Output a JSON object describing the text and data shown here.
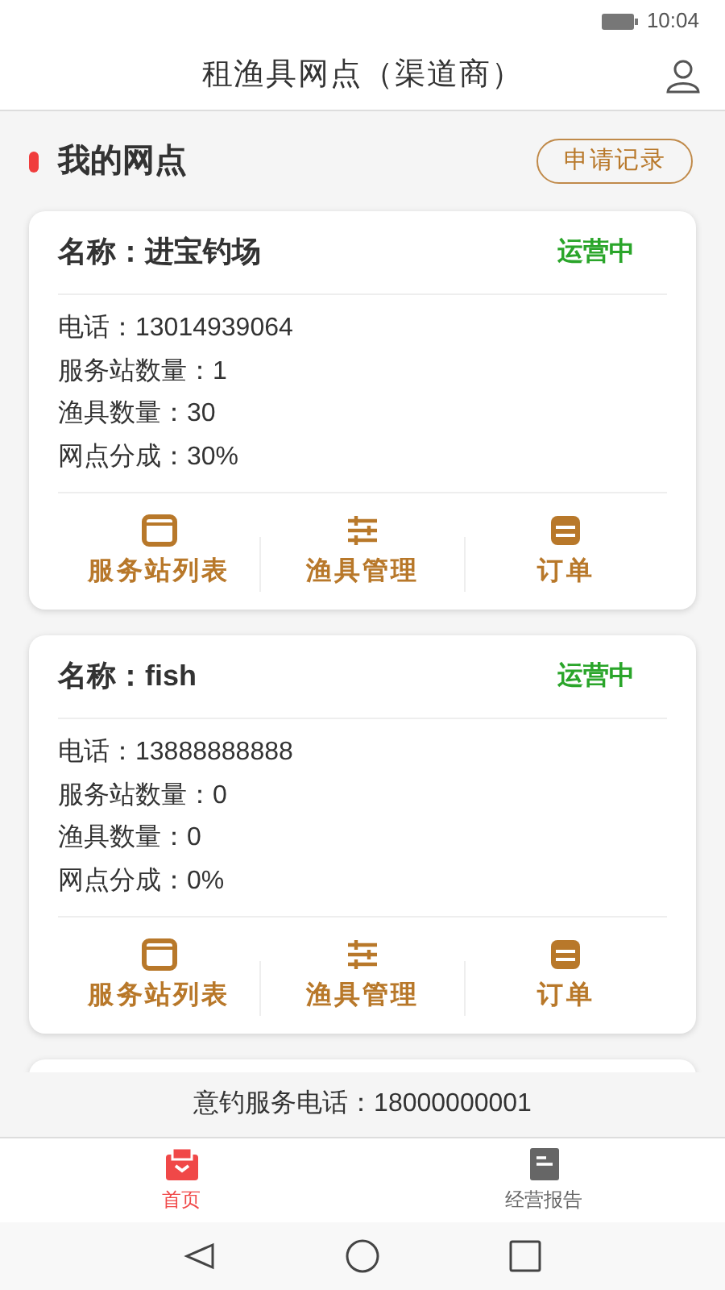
{
  "status_bar": {
    "time": "10:04"
  },
  "header": {
    "title": "租渔具网点（渠道商）"
  },
  "section": {
    "title": "我的网点",
    "action": "申请记录"
  },
  "outlets": [
    {
      "name": "名称：进宝钓场",
      "status": "运营中",
      "lines": [
        "电话：13014939064",
        "服务站数量：1",
        "渔具数量：30",
        "网点分成：30%"
      ],
      "actions": [
        {
          "kind": "window",
          "label": "服务站列表"
        },
        {
          "kind": "sliders",
          "label": "渔具管理"
        },
        {
          "kind": "list",
          "label": "订单"
        }
      ]
    },
    {
      "name": "名称：fish",
      "status": "运营中",
      "lines": [
        "电话：13888888888",
        "服务站数量：0",
        "渔具数量：0",
        "网点分成：0%"
      ],
      "actions": [
        {
          "kind": "window",
          "label": "服务站列表"
        },
        {
          "kind": "sliders",
          "label": "渔具管理"
        },
        {
          "kind": "list",
          "label": "订单"
        }
      ]
    }
  ],
  "hotline": "意钓服务电话：18000000001",
  "tabs": [
    {
      "kind": "home",
      "label": "首页",
      "selected": true
    },
    {
      "kind": "report",
      "label": "经营报告",
      "selected": false
    }
  ]
}
